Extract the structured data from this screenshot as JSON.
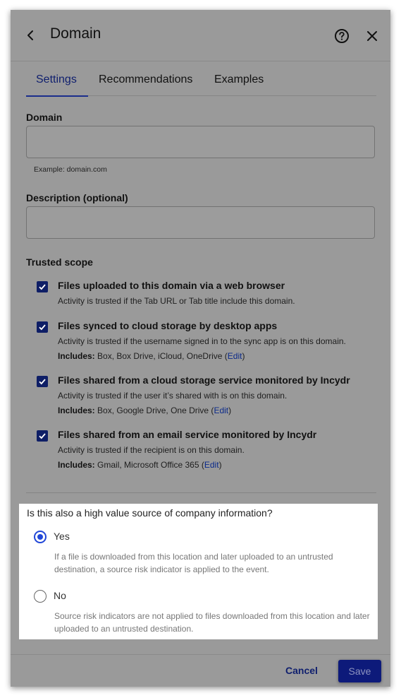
{
  "header": {
    "title": "Domain"
  },
  "tabs": [
    {
      "label": "Settings",
      "active": true
    },
    {
      "label": "Recommendations",
      "active": false
    },
    {
      "label": "Examples",
      "active": false
    }
  ],
  "domain_field": {
    "label": "Domain",
    "value": "",
    "hint": "Example: domain.com"
  },
  "description_field": {
    "label": "Description (optional)",
    "value": ""
  },
  "trusted_scope": {
    "label": "Trusted scope",
    "items": [
      {
        "checked": true,
        "title": "Files uploaded to this domain via a web browser",
        "description": "Activity is trusted if the Tab URL or Tab title include this domain."
      },
      {
        "checked": true,
        "title": "Files synced to cloud storage by desktop apps",
        "description": "Activity is trusted if the username signed in to the sync app is on this domain.",
        "includes_label": "Includes:",
        "includes": "Box, Box Drive, iCloud, OneDrive",
        "edit_label": "Edit"
      },
      {
        "checked": true,
        "title": "Files shared from a cloud storage service monitored by Incydr",
        "description": "Activity is trusted if the user it’s shared with is on this domain.",
        "includes_label": "Includes:",
        "includes": "Box, Google Drive, One Drive",
        "edit_label": "Edit"
      },
      {
        "checked": true,
        "title": "Files shared from an email service monitored by Incydr",
        "description": "Activity is trusted if the recipient is on this domain.",
        "includes_label": "Includes:",
        "includes": "Gmail, Microsoft Office 365",
        "edit_label": "Edit"
      }
    ]
  },
  "high_value": {
    "question": "Is this also a high value source of company information?",
    "selected": "Yes",
    "options": [
      {
        "label": "Yes",
        "description": "If a file is downloaded from this location and later uploaded to an untrusted destination, a source risk indicator is applied to the event."
      },
      {
        "label": "No",
        "description": "Source risk indicators are not applied to files downloaded from this location and later uploaded to an untrusted destination."
      }
    ]
  },
  "footer": {
    "cancel_label": "Cancel",
    "save_label": "Save"
  },
  "colors": {
    "overlay_gray": "#9a9a9a",
    "accent_dark_blue": "#0e1e66",
    "radio_blue": "#2147d8",
    "link_blue": "#0b2a8a"
  }
}
